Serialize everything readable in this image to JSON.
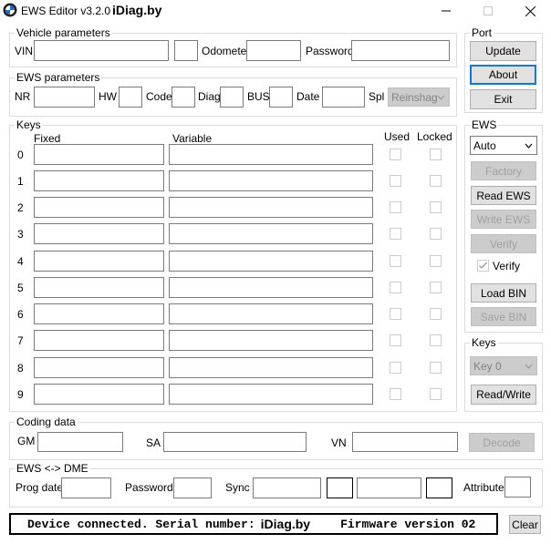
{
  "window": {
    "title": "EWS Editor v3.2.0",
    "brand": "iDiag.by"
  },
  "vehicle": {
    "group_label": "Vehicle parameters",
    "vin_label": "VIN",
    "vin_value": "",
    "extra_value": "",
    "odometer_label": "Odometer",
    "odometer_value": "",
    "password_label": "Password",
    "password_value": ""
  },
  "ews_params": {
    "group_label": "EWS parameters",
    "nr_label": "NR",
    "hw_label": "HW",
    "code_label": "Code",
    "diag_label": "Diag",
    "bus_label": "BUS",
    "date_label": "Date",
    "spl_label": "Spl",
    "spl_value": "Reinshag"
  },
  "keys_table": {
    "group_label": "Keys",
    "col_fixed": "Fixed",
    "col_variable": "Variable",
    "col_used": "Used",
    "col_locked": "Locked",
    "rows": [
      "0",
      "1",
      "2",
      "3",
      "4",
      "5",
      "6",
      "7",
      "8",
      "9"
    ]
  },
  "port": {
    "group_label": "Port",
    "update_label": "Update",
    "about_label": "About",
    "exit_label": "Exit"
  },
  "ews_panel": {
    "group_label": "EWS",
    "mode_value": "Auto",
    "factory_label": "Factory",
    "read_label": "Read EWS",
    "write_label": "Write EWS",
    "verify_button_label": "Verify",
    "verify_check_label": "Verify",
    "load_label": "Load BIN",
    "save_label": "Save BIN"
  },
  "keys_panel": {
    "group_label": "Keys",
    "key_value": "Key 0",
    "readwrite_label": "Read/Write"
  },
  "coding": {
    "group_label": "Coding data",
    "gm_label": "GM",
    "sa_label": "SA",
    "vn_label": "VN",
    "decode_label": "Decode"
  },
  "dme": {
    "group_label": "EWS <-> DME",
    "progdate_label": "Prog date",
    "password_label": "Password",
    "sync_label": "Sync",
    "attribute_label": "Attribute"
  },
  "status": {
    "prefix": "Device connected. Serial number:",
    "serial": "iDiag.by",
    "firmware": "Firmware version 02",
    "clear_label": "Clear"
  },
  "colors": {
    "accent": "#0078d7",
    "button_face": "#e1e1e1",
    "disabled_text": "#a0a0a0"
  }
}
